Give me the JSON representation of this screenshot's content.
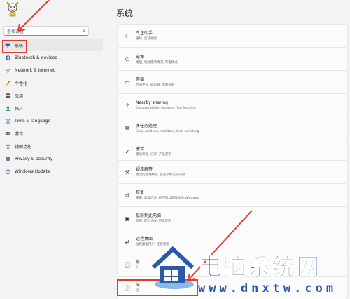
{
  "search": {
    "placeholder": "查找设置"
  },
  "sidebar": {
    "items": [
      {
        "label": "系统",
        "icon": "system-icon"
      },
      {
        "label": "Bluetooth & devices",
        "icon": "bluetooth-icon"
      },
      {
        "label": "Network & internet",
        "icon": "network-icon"
      },
      {
        "label": "个性化",
        "icon": "brush-icon"
      },
      {
        "label": "应用",
        "icon": "apps-icon"
      },
      {
        "label": "帐户",
        "icon": "account-icon"
      },
      {
        "label": "Time & language",
        "icon": "globe-icon"
      },
      {
        "label": "游戏",
        "icon": "gamepad-icon"
      },
      {
        "label": "辅助功能",
        "icon": "accessibility-icon"
      },
      {
        "label": "Privacy & security",
        "icon": "shield-icon"
      },
      {
        "label": "Windows Update",
        "icon": "update-icon"
      }
    ]
  },
  "main": {
    "title": "系统",
    "cards": [
      {
        "title": "专注助手",
        "subtitle": "通知, 自动规则",
        "icon": "moon-icon"
      },
      {
        "title": "电源",
        "subtitle": "睡眠, 电池使用情况, 节电模式",
        "icon": "power-icon"
      },
      {
        "title": "存储",
        "subtitle": "存储空间, 驱动器, 配置规则",
        "icon": "storage-icon"
      },
      {
        "title": "Nearby sharing",
        "subtitle": "Discoverability, received files location",
        "icon": "share-icon"
      },
      {
        "title": "多任务处理",
        "subtitle": "Snap windows, desktops, task switching",
        "icon": "multitask-icon"
      },
      {
        "title": "激活",
        "subtitle": "激活状态, 订阅, 产品密钥",
        "icon": "activation-icon"
      },
      {
        "title": "疑难解答",
        "subtitle": "建议的疑难解答, 首选项和历史记录",
        "icon": "wrench-icon"
      },
      {
        "title": "恢复",
        "subtitle": "重置, 高级启动, 返回到以前版本的 Windows",
        "icon": "recovery-icon"
      },
      {
        "title": "投影到此电脑",
        "subtitle": "权限, 配对 PIN, 可发现性",
        "icon": "projection-icon"
      },
      {
        "title": "远程桌面",
        "subtitle": "远程桌面用户, 连接权限",
        "icon": "remote-icon"
      },
      {
        "title": "剪",
        "subtitle": "C",
        "icon": "clipboard-icon"
      },
      {
        "title": "关",
        "subtitle": "设",
        "icon": "info-icon"
      }
    ]
  },
  "watermark": {
    "title": "电脑系统网",
    "url": "www.dnxtw.com"
  },
  "colors": {
    "annotation": "#e43d30",
    "watermark": "#2b5aa8"
  }
}
